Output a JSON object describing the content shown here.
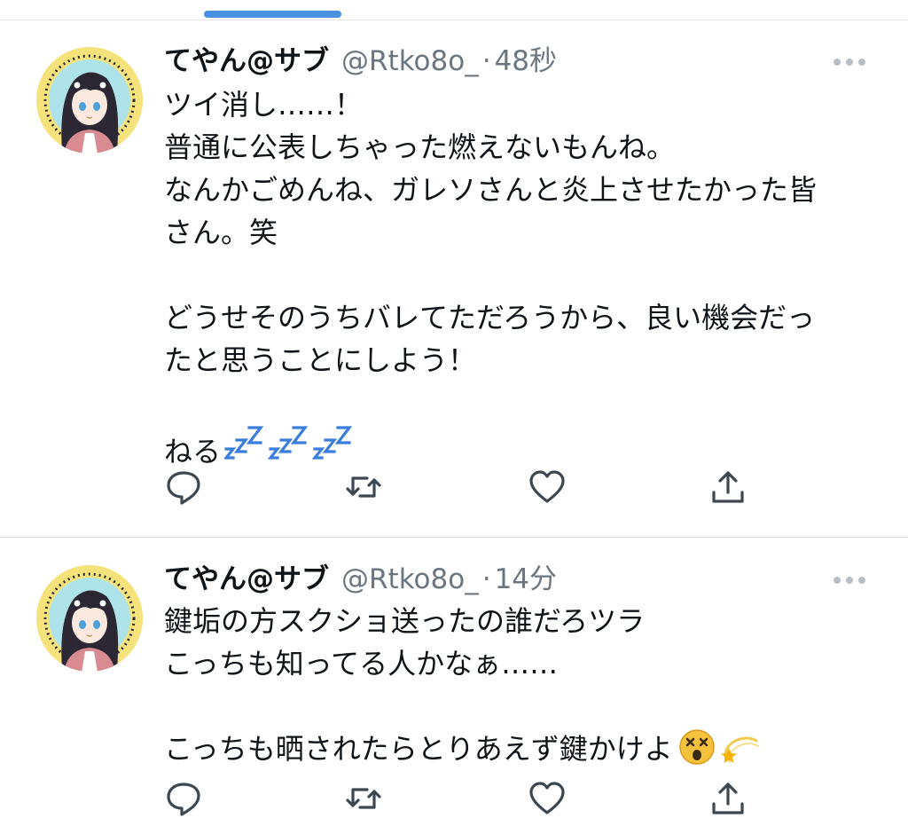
{
  "tweets": [
    {
      "name": "てやん@サブ",
      "handle": "@Rtko8o_",
      "dot": "·",
      "time": "48秒",
      "lines": [
        "ツイ消し……！",
        "普通に公表しちゃった燃えないもんね。",
        "なんかごめんね、ガレソさんと炎上させたかった皆",
        "さん。笑",
        "",
        "どうせそのうちバレてただろうから、良い機会だっ",
        "たと思うことにしよう！",
        ""
      ],
      "last_line_text": "ねる",
      "last_line_emoji": "zzz-icon",
      "actions": [
        "reply-icon",
        "retweet-icon",
        "like-icon",
        "share-icon"
      ]
    },
    {
      "name": "てやん@サブ",
      "handle": "@Rtko8o_",
      "dot": "·",
      "time": "14分",
      "lines": [
        "鍵垢の方スクショ送ったの誰だろツラ",
        "こっちも知ってる人かなぁ……",
        ""
      ],
      "last_line_text": "こっちも晒されたらとりあえず鍵かけよ",
      "last_line_emoji": "dizzy-face-icon, dizzy-star-icon",
      "actions": [
        "reply-icon",
        "retweet-icon",
        "like-icon",
        "share-icon"
      ]
    }
  ],
  "colors": {
    "text": "#0f1419",
    "secondary": "#6b7680",
    "accent": "#4a90e2",
    "zzz": "#3b7ddd",
    "separator": "#dcdcdc"
  }
}
